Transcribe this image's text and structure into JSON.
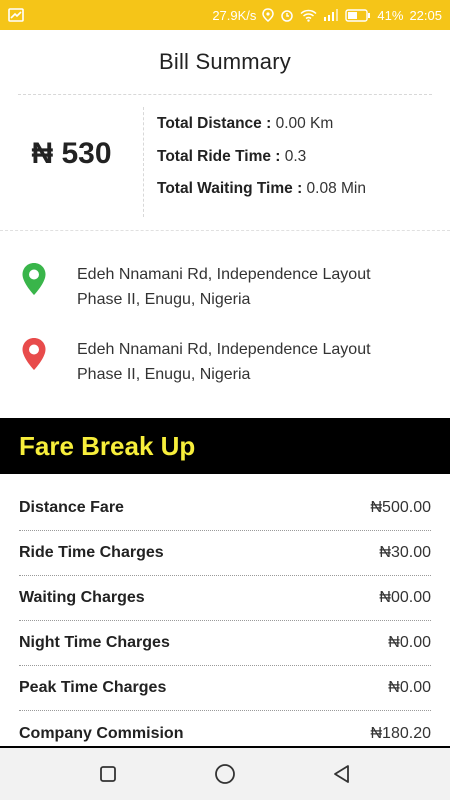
{
  "status_bar": {
    "speed": "27.9K/s",
    "battery": "41%",
    "time": "22:05",
    "color": "#f5c518"
  },
  "header": {
    "title": "Bill Summary"
  },
  "summary": {
    "amount": "₦ 530",
    "stats": [
      {
        "label": "Total Distance : ",
        "value": "0.00 Km"
      },
      {
        "label": "Total Ride Time : ",
        "value": "0.3"
      },
      {
        "label": "Total Waiting Time : ",
        "value": "0.08 Min"
      }
    ]
  },
  "locations": {
    "pickup": {
      "icon": "green-pin-icon",
      "color": "#39b54a",
      "line1": "Edeh Nnamani Rd, Independence Layout",
      "line2": "Phase II, Enugu, Nigeria"
    },
    "dropoff": {
      "icon": "red-pin-icon",
      "color": "#e84b4b",
      "line1": "Edeh Nnamani Rd, Independence Layout",
      "line2": "Phase II, Enugu, Nigeria"
    }
  },
  "fare": {
    "title": "Fare Break Up",
    "title_color": "#f7ee3b",
    "rows": [
      {
        "label": "Distance Fare",
        "value": "₦500.00"
      },
      {
        "label": "Ride Time Charges",
        "value": "₦30.00"
      },
      {
        "label": "Waiting Charges",
        "value": "₦00.00"
      },
      {
        "label": "Night Time Charges",
        "value": "₦0.00"
      },
      {
        "label": "Peak Time Charges",
        "value": "₦0.00"
      },
      {
        "label": "Company Commision",
        "value": "₦180.20"
      }
    ]
  },
  "nav": {
    "recents": "square-icon",
    "home": "circle-icon",
    "back": "triangle-back-icon"
  }
}
